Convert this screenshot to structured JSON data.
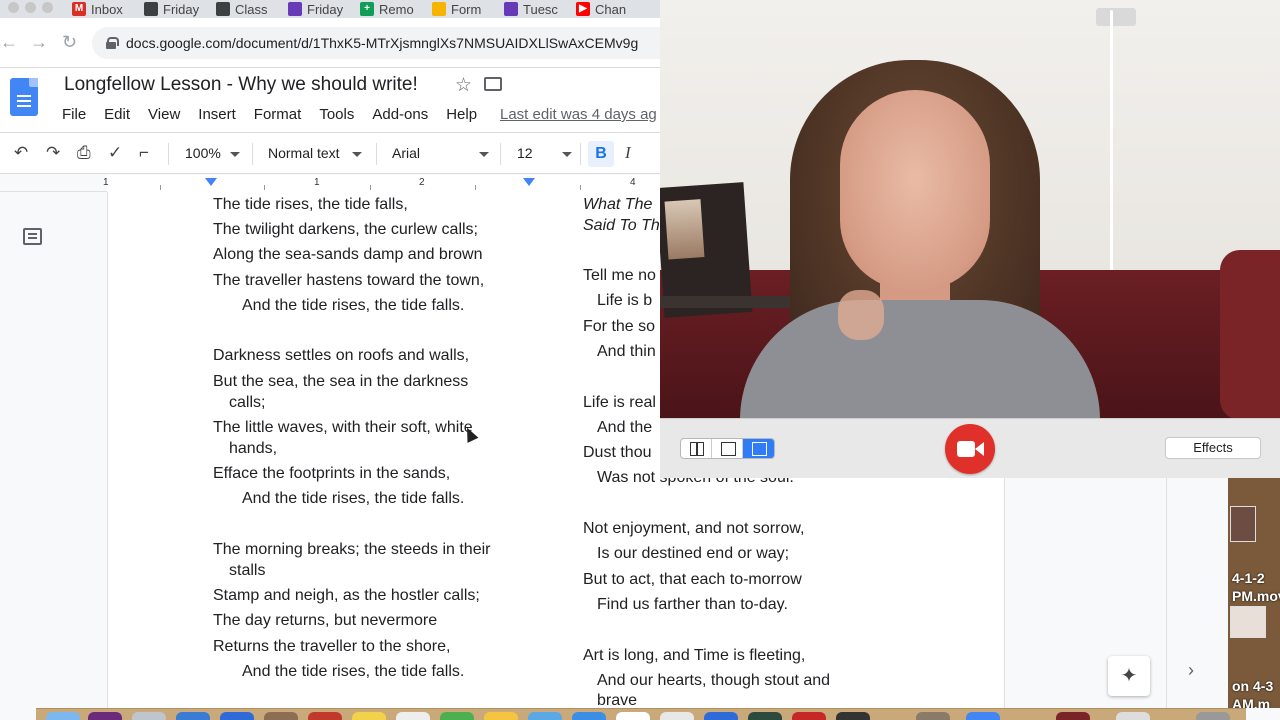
{
  "browser": {
    "tabs": [
      {
        "label": "Inbox",
        "icon": "gmail-icon",
        "color": "#d93025"
      },
      {
        "label": "Friday",
        "icon": "classroom-icon",
        "color": "#3c4043"
      },
      {
        "label": "Class",
        "icon": "classroom-icon",
        "color": "#3c4043"
      },
      {
        "label": "Friday",
        "icon": "forms-icon",
        "color": "#673ab7"
      },
      {
        "label": "Remo",
        "icon": "sheets-icon",
        "color": "#0f9d58"
      },
      {
        "label": "Form",
        "icon": "drive-icon",
        "color": "#f4b400"
      },
      {
        "label": "Tuesc",
        "icon": "forms-icon",
        "color": "#673ab7"
      },
      {
        "label": "Chan",
        "icon": "youtube-icon",
        "color": "#ff0000"
      }
    ],
    "url": "docs.google.com/document/d/1ThxK5-MTrXjsmnglXs7NMSUAIDXLlSwAxCEMv9g"
  },
  "docs": {
    "title": "Longfellow Lesson - Why we should write!",
    "menus": [
      "File",
      "Edit",
      "View",
      "Insert",
      "Format",
      "Tools",
      "Add-ons",
      "Help"
    ],
    "last_edit": "Last edit was 4 days ag",
    "toolbar": {
      "zoom": "100%",
      "style": "Normal text",
      "font": "Arial",
      "size": "12",
      "bold": "B",
      "italic": "I"
    },
    "ruler": [
      "1",
      "1",
      "2",
      "4"
    ]
  },
  "poem_left": [
    "The tide rises, the tide falls,",
    "The twilight darkens, the curlew calls;",
    "Along the sea-sands damp and brown",
    "The traveller hastens toward the town,",
    "And the tide rises, the tide falls.",
    "Darkness settles on roofs and walls,",
    "But the sea, the sea in the darkness",
    "calls;",
    "The little waves, with their soft, white",
    "hands,",
    "Efface the footprints in the sands,",
    "And the tide rises, the tide falls.",
    "The morning breaks; the steeds in their",
    "stalls",
    "Stamp and neigh, as the hostler calls;",
    "The day returns, but nevermore",
    "Returns the traveller to the shore,",
    "And the tide rises, the tide falls."
  ],
  "poem_right": [
    "What The",
    "Said To Th",
    "Tell me no",
    "Life is b",
    "For the so",
    "And thin",
    "Life is real",
    "And the",
    "Dust thou",
    "Was not spoken of the soul.",
    "Not enjoyment, and not sorrow,",
    "Is our destined end or way;",
    "But to act, that each to-morrow",
    "Find us farther than to-day.",
    "Art is long, and Time is fleeting,",
    "And our hearts, though stout and",
    "brave"
  ],
  "video": {
    "effects_label": "Effects",
    "accent": "#e0302a"
  },
  "desktop": {
    "file1_line1": "4-1-2",
    "file1_line2": "PM.mov",
    "file2_line1": "on 4-3",
    "file2_line2": "AM.m"
  }
}
